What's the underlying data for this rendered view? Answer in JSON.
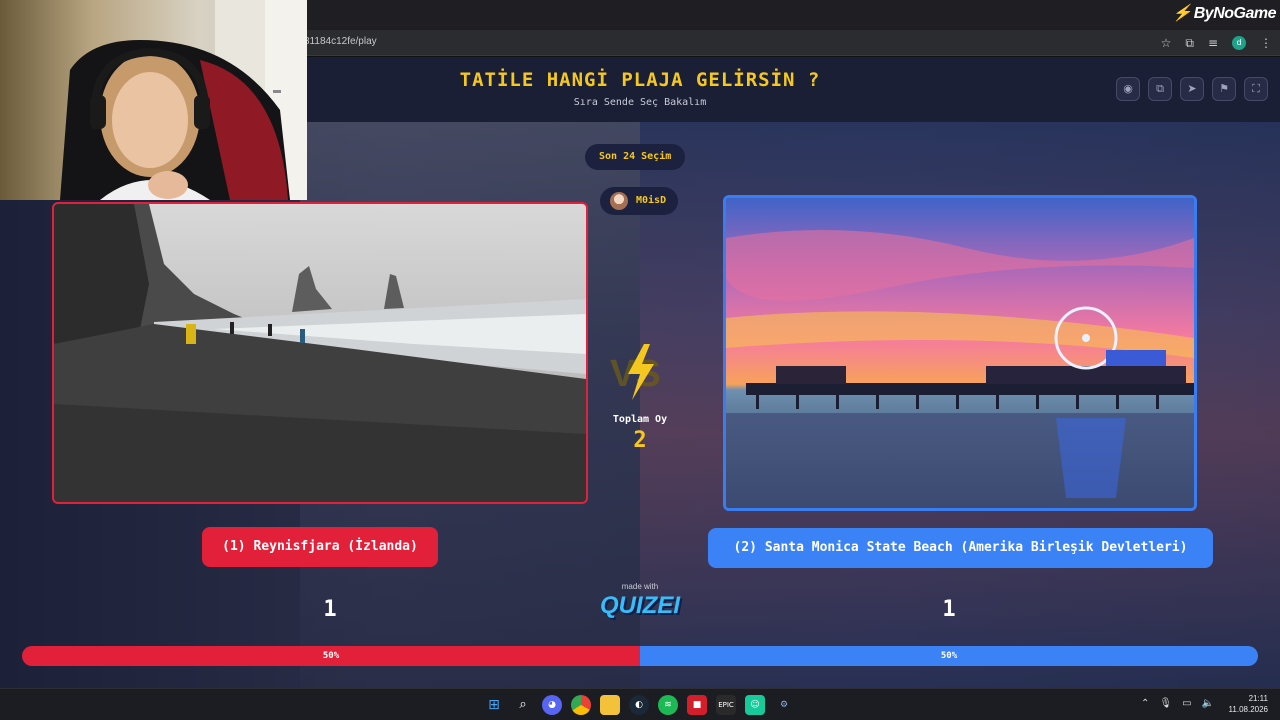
{
  "brand": "ByNoGame",
  "browser": {
    "url": "81184c12fe/play"
  },
  "header": {
    "title": "TATİLE HANGİ PLAJA GELİRSİN ?",
    "subtitle": "Sıra Sende Seç Bakalım",
    "tools": [
      "eye-icon",
      "copy-icon",
      "send-icon",
      "flag-icon",
      "fullscreen-icon"
    ]
  },
  "round": {
    "label": "Son 24 Seçim",
    "user": "M0isD"
  },
  "vote": {
    "total_label": "Toplam Oy",
    "total": "2"
  },
  "left": {
    "label": "(1) Reynisfjara (İzlanda)",
    "count": "1",
    "percent_label": "50%",
    "share": 0.5,
    "color": "#e3203a"
  },
  "right": {
    "label": "(2) Santa Monica State Beach (Amerika Birleşik Devletleri)",
    "count": "1",
    "percent_label": "50%",
    "share": 0.5,
    "color": "#3b82f6"
  },
  "footer": {
    "made_with": "made with",
    "logo": "QUIZEI"
  },
  "taskbar": {
    "apps": [
      "windows-icon",
      "search-icon",
      "discord-icon",
      "chrome-icon",
      "file-explorer-icon",
      "steam-icon",
      "spotify-icon",
      "red-app-icon",
      "epic-games-icon",
      "app-icon",
      "settings-icon"
    ],
    "time": "21:11",
    "date": "11.08.2026"
  }
}
